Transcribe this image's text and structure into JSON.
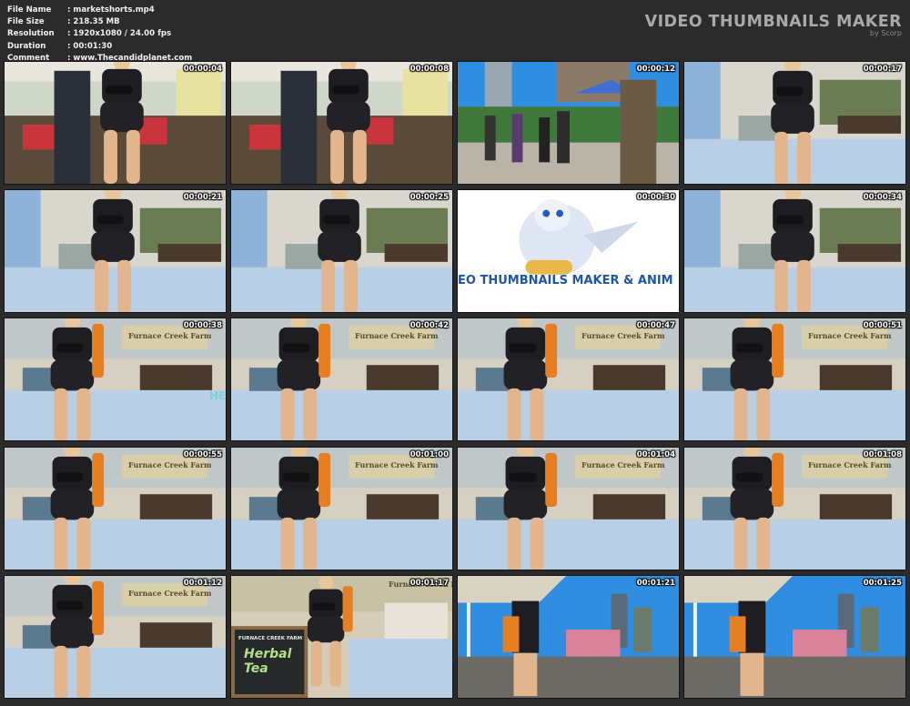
{
  "info": {
    "rows": [
      {
        "label": "File Name",
        "value": ":  marketshorts.mp4"
      },
      {
        "label": "File Size",
        "value": ":  218.35 MB"
      },
      {
        "label": "Resolution",
        "value": ":  1920x1080 / 24.00 fps"
      },
      {
        "label": "Duration",
        "value": ":  00:01:30"
      },
      {
        "label": "Comment",
        "value": ":  www.Thecandidplanet.com"
      }
    ]
  },
  "brand": {
    "title": "VIDEO THUMBNAILS MAKER",
    "sub": "by Scorp"
  },
  "thumbnails": [
    {
      "time": "00:00:04",
      "scene": "stall-red"
    },
    {
      "time": "00:00:08",
      "scene": "stall-red"
    },
    {
      "time": "00:00:12",
      "scene": "street"
    },
    {
      "time": "00:00:17",
      "scene": "stall-blue"
    },
    {
      "time": "00:00:21",
      "scene": "stall-blue"
    },
    {
      "time": "00:00:25",
      "scene": "stall-blue"
    },
    {
      "time": "00:00:30",
      "scene": "logo"
    },
    {
      "time": "00:00:34",
      "scene": "stall-blue"
    },
    {
      "time": "00:00:38",
      "scene": "stall-sign"
    },
    {
      "time": "00:00:42",
      "scene": "stall-sign"
    },
    {
      "time": "00:00:47",
      "scene": "stall-sign"
    },
    {
      "time": "00:00:51",
      "scene": "stall-sign"
    },
    {
      "time": "00:00:55",
      "scene": "stall-sign"
    },
    {
      "time": "00:01:00",
      "scene": "stall-sign"
    },
    {
      "time": "00:01:04",
      "scene": "stall-sign"
    },
    {
      "time": "00:01:08",
      "scene": "stall-sign"
    },
    {
      "time": "00:01:12",
      "scene": "stall-sign"
    },
    {
      "time": "00:01:17",
      "scene": "chalkboard"
    },
    {
      "time": "00:01:21",
      "scene": "city"
    },
    {
      "time": "00:01:25",
      "scene": "city"
    }
  ],
  "overlays": {
    "logo_text": "EO THUMBNAILS MAKER & ANIM",
    "sign_text": "Furnace Creek Farm",
    "chalk_text": "Herbal\nTea",
    "chalk_header": "FURNACE CREEK FARM",
    "board_text": "HE"
  },
  "colors": {
    "background": "#2b2b2b",
    "tablecloth": "#b8cfe6",
    "shirt": "#1e1e22",
    "orange_bag": "#e67e22",
    "sky": "#2f8ee0"
  }
}
